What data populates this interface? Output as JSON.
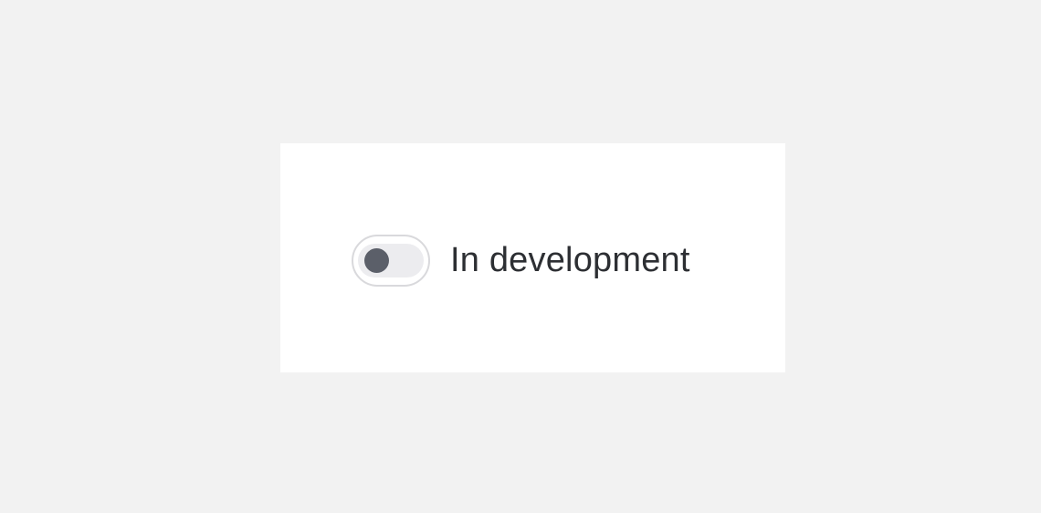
{
  "toggle": {
    "label": "In development",
    "checked": false
  },
  "colors": {
    "page_background": "#f2f2f2",
    "card_background": "#ffffff",
    "track": "#ececef",
    "thumb": "#5b5f69",
    "outline": "#d9d9dc",
    "label_text": "#2d2f33"
  },
  "icons": {
    "thumb": "toggle-thumb-icon"
  }
}
